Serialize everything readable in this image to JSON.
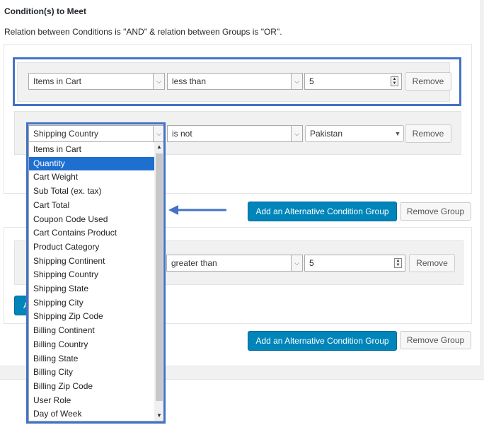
{
  "heading": "Condition(s) to Meet",
  "relation_text": "Relation between Conditions is \"AND\" & relation between Groups is \"OR\".",
  "group1": {
    "row1": {
      "field": "Items in Cart",
      "operator": "less than",
      "value": "5",
      "remove": "Remove"
    },
    "row2": {
      "field": "Shipping Country",
      "operator": "is not",
      "value": "Pakistan",
      "remove": "Remove"
    },
    "add_group": "Add an Alternative Condition Group",
    "remove_group": "Remove Group"
  },
  "group2": {
    "row1": {
      "operator": "greater than",
      "value": "5",
      "remove": "Remove"
    },
    "add_partial": "A",
    "add_group": "Add an Alternative Condition Group",
    "remove_group": "Remove Group"
  },
  "dropdown": {
    "selected_index": 1,
    "items": [
      "Items in Cart",
      "Quantity",
      "Cart Weight",
      "Sub Total (ex. tax)",
      "Cart Total",
      "Coupon Code Used",
      "Cart Contains Product",
      "Product Category",
      "Shipping Continent",
      "Shipping Country",
      "Shipping State",
      "Shipping City",
      "Shipping Zip Code",
      "Billing Continent",
      "Billing Country",
      "Billing State",
      "Billing City",
      "Billing Zip Code",
      "User Role",
      "Day of Week"
    ]
  },
  "colors": {
    "highlight": "#4472c4",
    "primary_button": "#0085ba",
    "selected_item": "#1e6fd0"
  }
}
